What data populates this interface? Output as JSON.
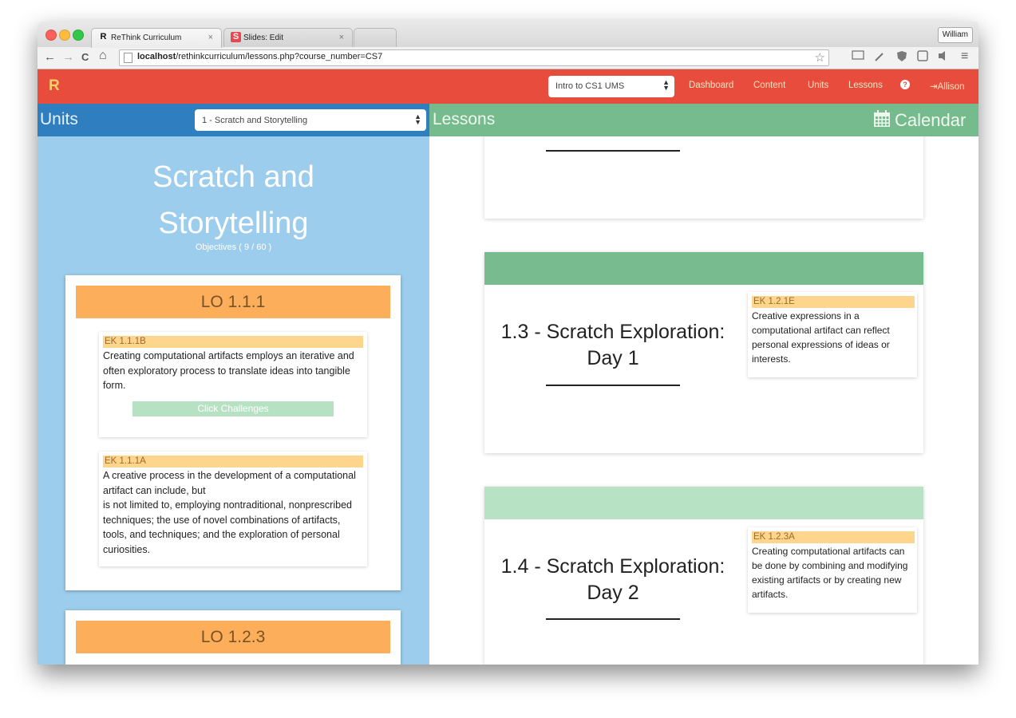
{
  "browser": {
    "tabs": [
      {
        "title": "ReThink Curriculum",
        "favicon": "R",
        "close": "×"
      },
      {
        "title": "Slides: Edit",
        "favicon": "S",
        "close": "×"
      }
    ],
    "user_button": "William",
    "url_host": "localhost",
    "url_path": "/rethinkcurriculum/lessons.php?course_number=CS7",
    "icons": {
      "back": "←",
      "forward": "→",
      "reload": "C",
      "home": "⌂",
      "star": "☆",
      "menu": "≡"
    }
  },
  "nav": {
    "brand": "R",
    "course_select": "Intro to CS1 UMS",
    "links": {
      "dashboard": "Dashboard",
      "content": "Content",
      "units": "Units",
      "lessons": "Lessons"
    },
    "help_icon": "?",
    "user": "Allison",
    "user_icon": "⇥"
  },
  "units_header": {
    "title": "Units",
    "unit_select": "1 - Scratch and Storytelling"
  },
  "lessons_header": {
    "title": "Lessons",
    "calendar": "Calendar"
  },
  "unit": {
    "name_line1": "Scratch and",
    "name_line2": "Storytelling",
    "objectives": "Objectives ( 9 / 60 )"
  },
  "learning_objectives": [
    {
      "title": "LO 1.1.1",
      "eks": [
        {
          "tag": "EK 1.1.1B",
          "text": "Creating computational artifacts employs an iterative and often exploratory process to translate ideas into tangible form.",
          "button": "Click Challenges"
        },
        {
          "tag": "EK 1.1.1A",
          "text_line1": "A creative process in the development of a computational artifact can include, but",
          "text_line2": "is not limited to, employing nontraditional, nonprescribed techniques; the use of novel combinations of artifacts, tools, and techniques; and the exploration of personal curiosities."
        }
      ]
    },
    {
      "title": "LO 1.2.3"
    }
  ],
  "lessons": [
    {
      "title": "",
      "band_color": "#ffffff"
    },
    {
      "title": "1.3 - Scratch Exploration: Day 1",
      "band_color": "#78bb8f",
      "ek": {
        "tag": "EK 1.2.1E",
        "text": "Creative expressions in a computational artifact can reflect personal expressions of ideas or interests."
      }
    },
    {
      "title": "1.4 - Scratch Exploration: Day 2",
      "band_color": "#b7e2c4",
      "ek": {
        "tag": "EK 1.2.3A",
        "text": "Creating computational artifacts can be done by combining and modifying existing artifacts or by creating new artifacts."
      }
    }
  ],
  "colors": {
    "nav": "#e74c3c",
    "units_header": "#2f7ebf",
    "units_panel": "#9ccdec",
    "lessons_header": "#76bb8e",
    "lo_head": "#fcae5a",
    "ek_tag": "#fdd58c"
  }
}
